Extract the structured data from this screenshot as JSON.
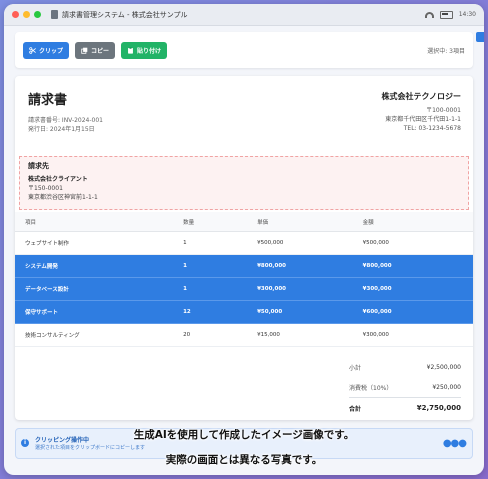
{
  "window": {
    "title": "請求書管理システム - 株式会社サンプル",
    "time": "14:30"
  },
  "toolbar": {
    "clip_label": "クリップ",
    "copy_label": "コピー",
    "paste_label": "貼り付け",
    "selected_text": "選択中: 3項目"
  },
  "invoice": {
    "title": "請求書",
    "number": "請求書番号: INV-2024-001",
    "date": "発行日: 2024年1月15日",
    "company": {
      "name": "株式会社テクノロジー",
      "postal": "〒100-0001",
      "address": "東京都千代田区千代田1-1-1",
      "tel": "TEL: 03-1234-5678"
    },
    "bill_to": {
      "label": "請求先",
      "client": "株式会社クライアント",
      "postal": "〒150-0001",
      "address": "東京都渋谷区神宮前1-1-1"
    },
    "columns": [
      "項目",
      "数量",
      "単価",
      "金額"
    ],
    "rows": [
      [
        "ウェブサイト制作",
        "1",
        "¥500,000",
        "¥500,000"
      ],
      [
        "システム開発",
        "1",
        "¥800,000",
        "¥800,000"
      ],
      [
        "データベース設計",
        "1",
        "¥300,000",
        "¥300,000"
      ],
      [
        "保守サポート",
        "12",
        "¥50,000",
        "¥600,000"
      ],
      [
        "技術コンサルティング",
        "20",
        "¥15,000",
        "¥300,000"
      ]
    ],
    "selected_rows": [
      1,
      2,
      3
    ],
    "totals": {
      "subtotal_label": "小計",
      "subtotal": "¥2,500,000",
      "tax_label": "消費税（10%）",
      "tax": "¥250,000",
      "total_label": "合計",
      "total": "¥2,750,000"
    }
  },
  "clipboard_bar": {
    "title": "クリッピング操作中",
    "subtitle": "選択された項目をクリップボードにコピーします"
  },
  "caption": {
    "line1": "生成AIを使用して作成したイメージ画像です。",
    "line2": "実際の画面とは異なる写真です。"
  },
  "colors": {
    "accent": "#2f7de1",
    "copy_button": "#6c757d",
    "paste_button": "#22b367",
    "bill_to_bg": "#fdf2f2"
  }
}
